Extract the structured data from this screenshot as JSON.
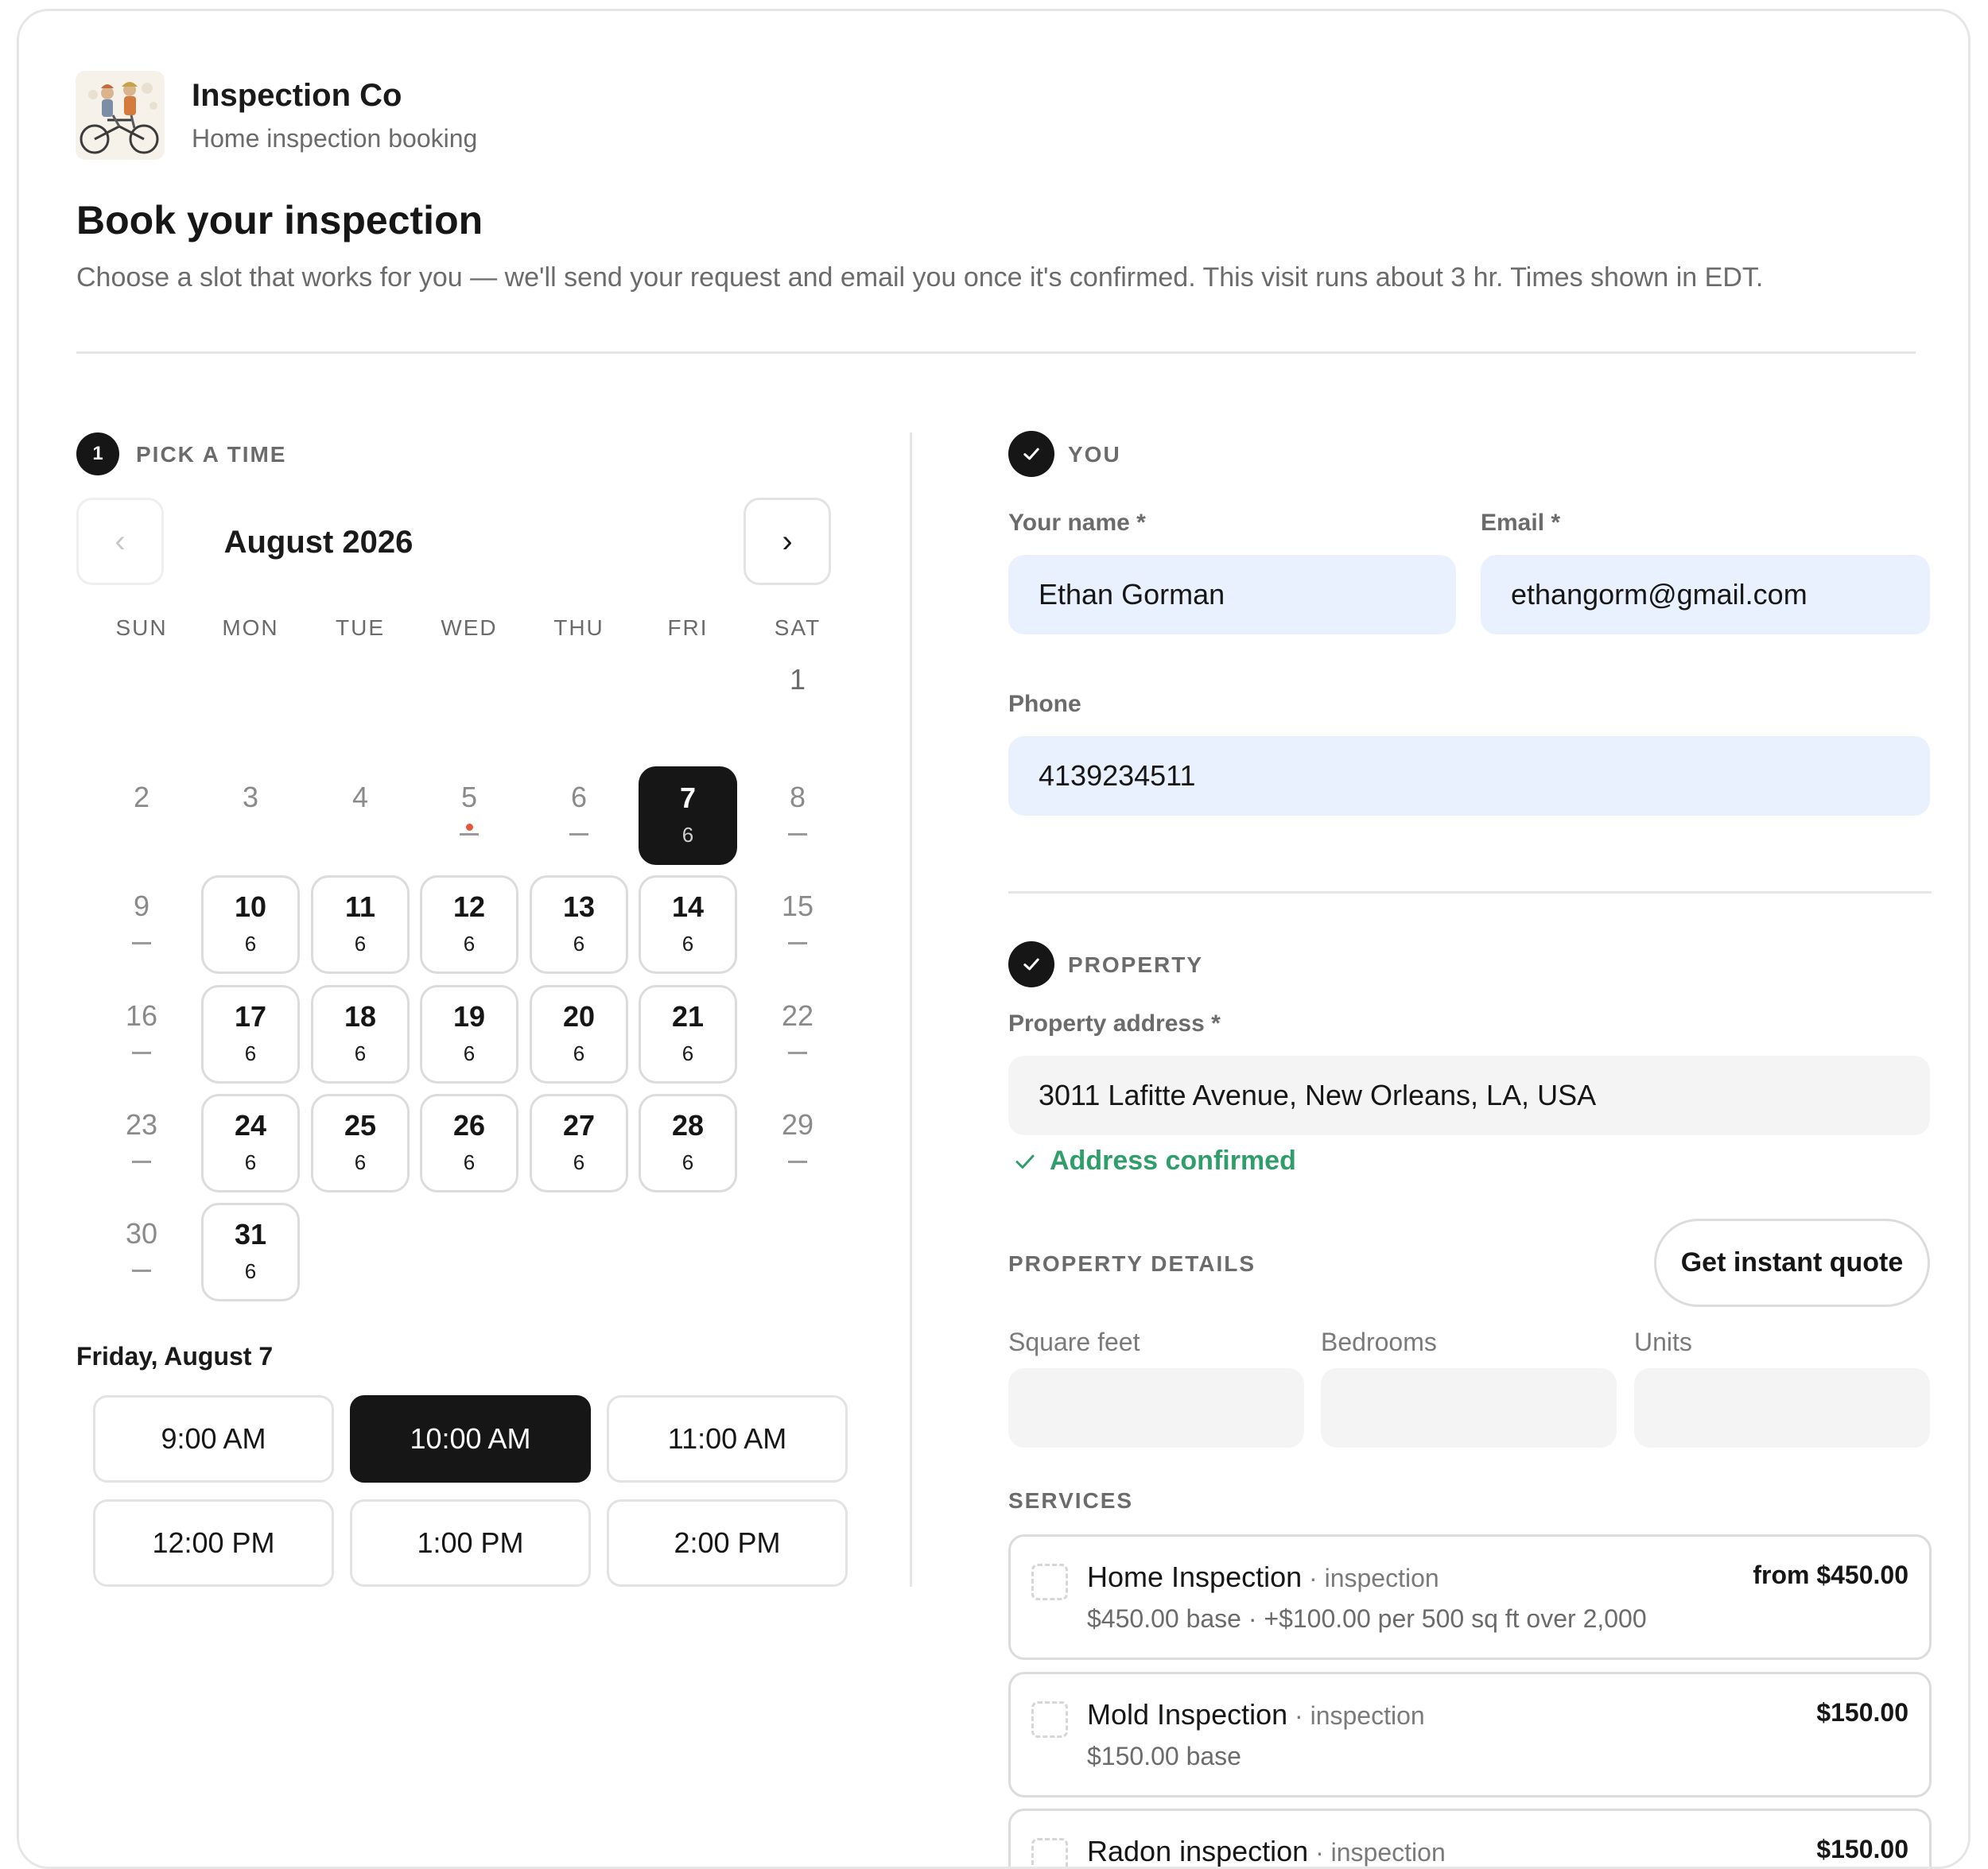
{
  "brand": {
    "name": "Inspection Co",
    "subtitle": "Home inspection booking"
  },
  "page": {
    "title": "Book your inspection",
    "description": "Choose a slot that works for you — we'll send your request and email you once it's confirmed. This visit runs about 3 hr. Times shown in EDT."
  },
  "pick_time": {
    "step": "1",
    "label": "PICK A TIME",
    "month": "August 2026",
    "prev_label": "‹",
    "next_label": "›",
    "weekdays": [
      "SUN",
      "MON",
      "TUE",
      "WED",
      "THU",
      "FRI",
      "SAT"
    ],
    "days": [
      {
        "num": "1",
        "sub": "",
        "state": "first"
      },
      {
        "num": "2",
        "sub": "",
        "state": "none"
      },
      {
        "num": "3",
        "sub": "",
        "state": "none"
      },
      {
        "num": "4",
        "sub": "",
        "state": "none"
      },
      {
        "num": "5",
        "sub": "—",
        "state": "today"
      },
      {
        "num": "6",
        "sub": "—",
        "state": "unavailable"
      },
      {
        "num": "7",
        "sub": "6",
        "state": "selected"
      },
      {
        "num": "8",
        "sub": "—",
        "state": "unavailable"
      },
      {
        "num": "9",
        "sub": "—",
        "state": "unavailable"
      },
      {
        "num": "10",
        "sub": "6",
        "state": "available"
      },
      {
        "num": "11",
        "sub": "6",
        "state": "available"
      },
      {
        "num": "12",
        "sub": "6",
        "state": "available"
      },
      {
        "num": "13",
        "sub": "6",
        "state": "available"
      },
      {
        "num": "14",
        "sub": "6",
        "state": "available"
      },
      {
        "num": "15",
        "sub": "—",
        "state": "unavailable"
      },
      {
        "num": "16",
        "sub": "—",
        "state": "unavailable"
      },
      {
        "num": "17",
        "sub": "6",
        "state": "available"
      },
      {
        "num": "18",
        "sub": "6",
        "state": "available"
      },
      {
        "num": "19",
        "sub": "6",
        "state": "available"
      },
      {
        "num": "20",
        "sub": "6",
        "state": "available"
      },
      {
        "num": "21",
        "sub": "6",
        "state": "available"
      },
      {
        "num": "22",
        "sub": "—",
        "state": "unavailable"
      },
      {
        "num": "23",
        "sub": "—",
        "state": "unavailable"
      },
      {
        "num": "24",
        "sub": "6",
        "state": "available"
      },
      {
        "num": "25",
        "sub": "6",
        "state": "available"
      },
      {
        "num": "26",
        "sub": "6",
        "state": "available"
      },
      {
        "num": "27",
        "sub": "6",
        "state": "available"
      },
      {
        "num": "28",
        "sub": "6",
        "state": "available"
      },
      {
        "num": "29",
        "sub": "—",
        "state": "unavailable"
      },
      {
        "num": "30",
        "sub": "—",
        "state": "unavailable"
      },
      {
        "num": "31",
        "sub": "6",
        "state": "available"
      }
    ],
    "selected_date": "Friday, August 7",
    "slots": [
      {
        "label": "9:00 AM",
        "selected": false
      },
      {
        "label": "10:00 AM",
        "selected": true
      },
      {
        "label": "11:00 AM",
        "selected": false
      },
      {
        "label": "12:00 PM",
        "selected": false
      },
      {
        "label": "1:00 PM",
        "selected": false
      },
      {
        "label": "2:00 PM",
        "selected": false
      }
    ]
  },
  "you": {
    "label": "YOU",
    "name_label": "Your name *",
    "name_value": "Ethan Gorman",
    "email_label": "Email *",
    "email_value": "ethangorm@gmail.com",
    "phone_label": "Phone",
    "phone_value": "4139234511"
  },
  "property": {
    "label": "PROPERTY",
    "address_label": "Property address *",
    "address_value": "3011 Lafitte Avenue, New Orleans, LA, USA",
    "address_status": "Address confirmed",
    "details_label": "PROPERTY DETAILS",
    "quote_button": "Get instant quote",
    "sqft_label": "Square feet",
    "sqft_value": "",
    "bedrooms_label": "Bedrooms",
    "bedrooms_value": "",
    "units_label": "Units",
    "units_value": ""
  },
  "services": {
    "label": "SERVICES",
    "items": [
      {
        "name": "Home Inspection",
        "kind": " · inspection",
        "detail": "$450.00 base · +$100.00 per 500 sq ft over 2,000",
        "price": "from $450.00"
      },
      {
        "name": "Mold Inspection",
        "kind": " · inspection",
        "detail": "$150.00 base",
        "price": "$150.00"
      },
      {
        "name": "Radon inspection",
        "kind": " · inspection",
        "detail": "",
        "price": "$150.00"
      }
    ]
  },
  "colors": {
    "accent_dark": "#161616",
    "input_fill": "#e9f1ff",
    "success": "#2f9e6b",
    "today_dot": "#e8563a"
  }
}
